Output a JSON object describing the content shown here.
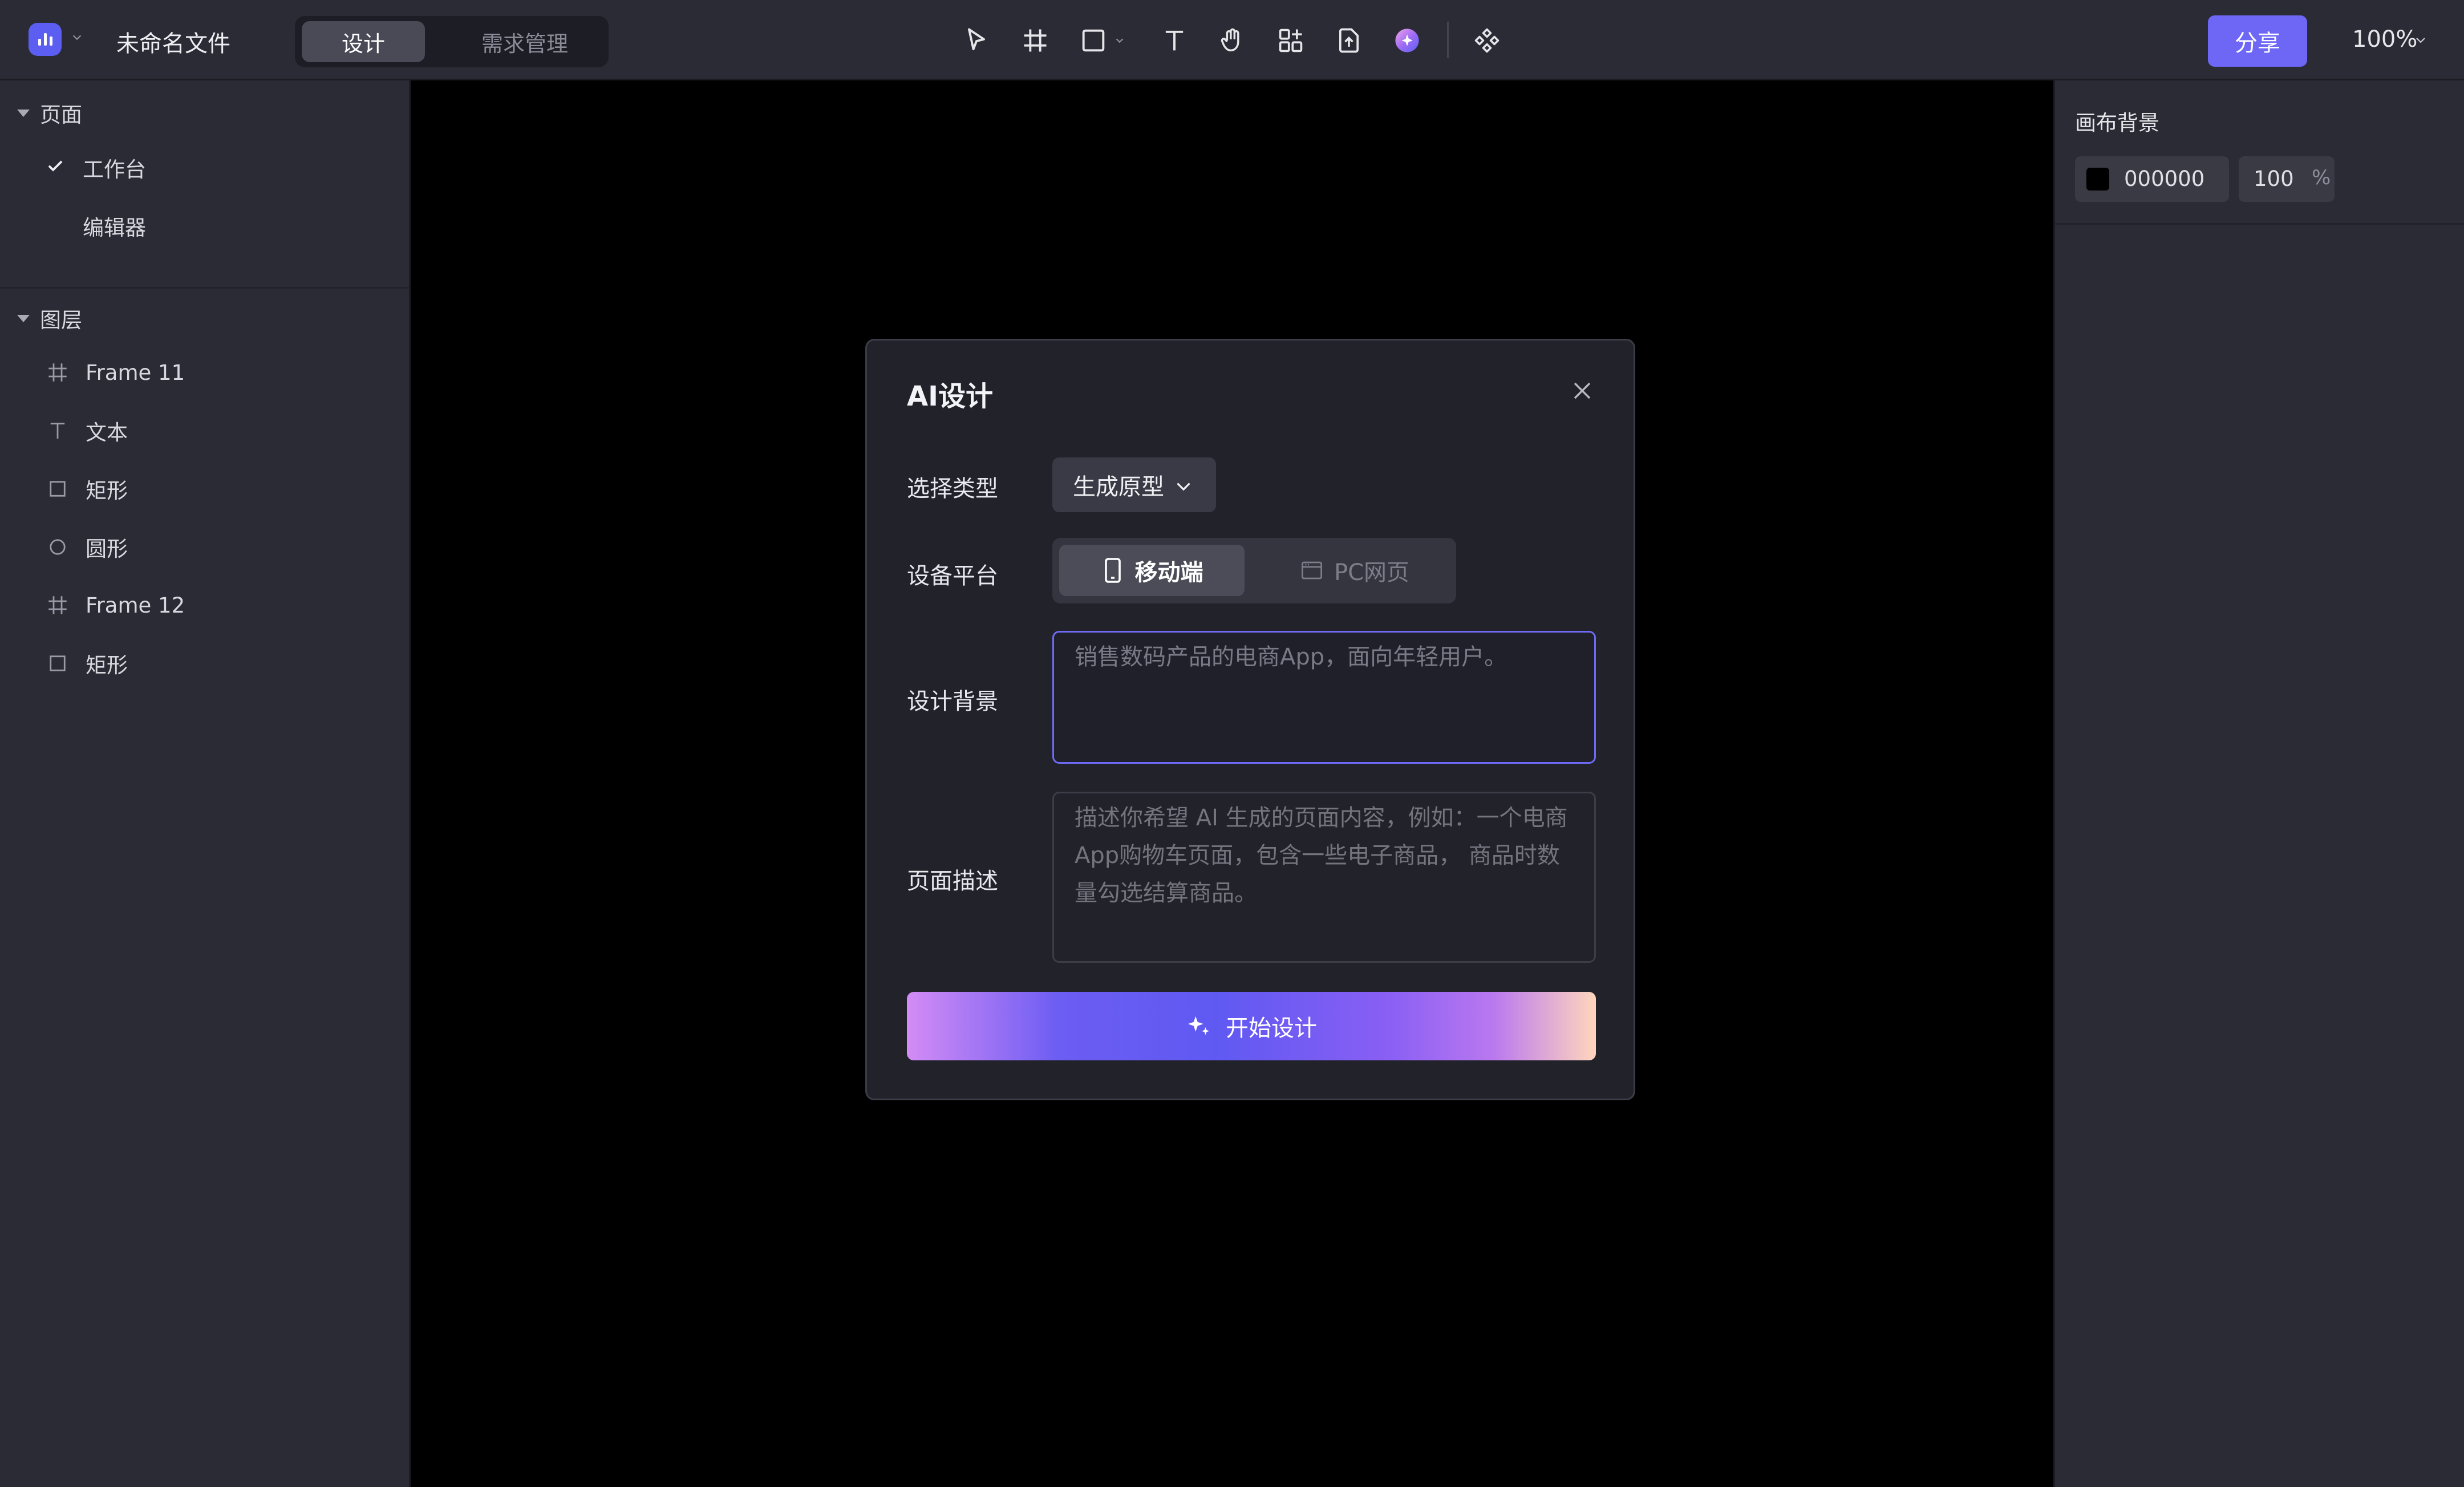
{
  "header": {
    "file_name": "未命名文件",
    "tabs": [
      {
        "label": "设计",
        "active": true
      },
      {
        "label": "需求管理",
        "active": false
      }
    ],
    "tools": [
      "pointer-icon",
      "frame-icon",
      "rectangle-icon",
      "text-icon",
      "hand-icon",
      "components-icon",
      "export-icon",
      "ai-orb-icon",
      "component-diamond-icon"
    ],
    "share_label": "分享",
    "zoom": "100%",
    "accent_color": "#6e67f6"
  },
  "pages": {
    "heading": "页面",
    "items": [
      {
        "label": "工作台",
        "selected": true
      },
      {
        "label": "编辑器",
        "selected": false
      }
    ]
  },
  "layers": {
    "heading": "图层",
    "items": [
      {
        "label": "Frame 11",
        "icon": "frame-icon"
      },
      {
        "label": "文本",
        "icon": "text-icon"
      },
      {
        "label": "矩形",
        "icon": "rectangle-icon"
      },
      {
        "label": "圆形",
        "icon": "circle-icon"
      },
      {
        "label": "Frame 12",
        "icon": "frame-icon"
      },
      {
        "label": "矩形",
        "icon": "rectangle-icon"
      }
    ]
  },
  "inspector": {
    "title": "画布背景",
    "color_hex": "000000",
    "opacity": "100",
    "opacity_unit": "%",
    "swatch_color": "#000000"
  },
  "dialog": {
    "title": "AI设计",
    "type_label": "选择类型",
    "type_value": "生成原型",
    "platform_label": "设备平台",
    "platform_options": [
      {
        "label": "移动端",
        "active": true
      },
      {
        "label": "PC网页",
        "active": false
      }
    ],
    "background_label": "设计背景",
    "background_placeholder": "销售数码产品的电商App，面向年轻用户。",
    "description_label": "页面描述",
    "description_placeholder": "描述你希望 AI 生成的页面内容，例如：一个电商App购物车页面，包含一些电子商品， 商品时数量勾选结算商品。",
    "start_label": "开始设计"
  }
}
